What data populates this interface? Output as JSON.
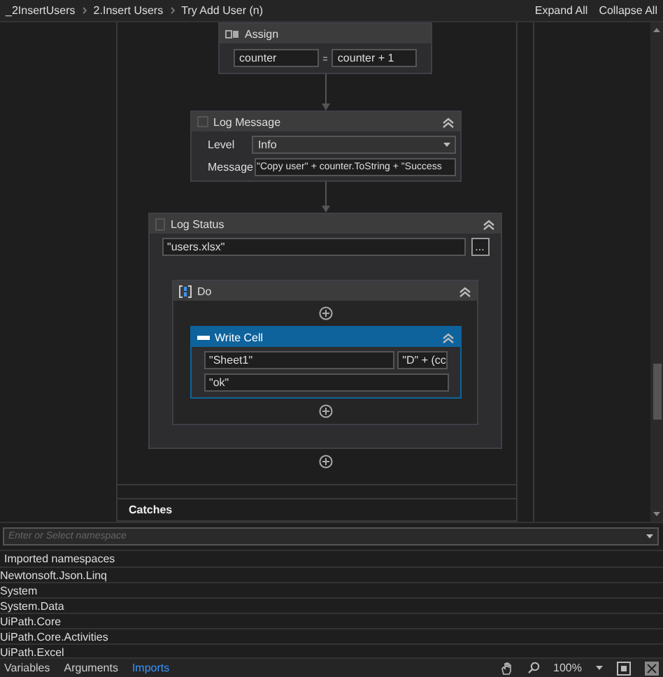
{
  "breadcrumbs": [
    "_2InsertUsers",
    "2.Insert Users",
    "Try Add User (n)"
  ],
  "header_actions": [
    "Expand All",
    "Collapse All"
  ],
  "assign": {
    "title": "Assign",
    "to": "counter",
    "value": "counter + 1"
  },
  "log_message": {
    "title": "Log Message",
    "expanded": true,
    "level_label": "Level",
    "level": "Info",
    "message_label": "Message",
    "message": "\"Copy user\" + counter.ToString + \"Success"
  },
  "log_status": {
    "title": "Log Status",
    "expanded": true,
    "file": "\"users.xlsx\"",
    "browse": "..."
  },
  "do": {
    "title": "Do",
    "expanded": true
  },
  "write_cell": {
    "title": "Write Cell",
    "expanded": true,
    "sheet": "\"Sheet1\"",
    "cell": "\"D\" + (cc",
    "value": "\"ok\""
  },
  "catches": "Catches",
  "namespace_field": {
    "placeholder": "Enter or Select namespace"
  },
  "imports_header": "Imported namespaces",
  "imports": [
    "Newtonsoft.Json.Linq",
    "System",
    "System.Data",
    "UiPath.Core",
    "UiPath.Core.Activities",
    "UiPath.Excel"
  ],
  "bottom_tabs": [
    {
      "label": "Variables",
      "selected": false
    },
    {
      "label": "Arguments",
      "selected": false
    },
    {
      "label": "Imports",
      "selected": true
    }
  ],
  "zoom": "100%"
}
